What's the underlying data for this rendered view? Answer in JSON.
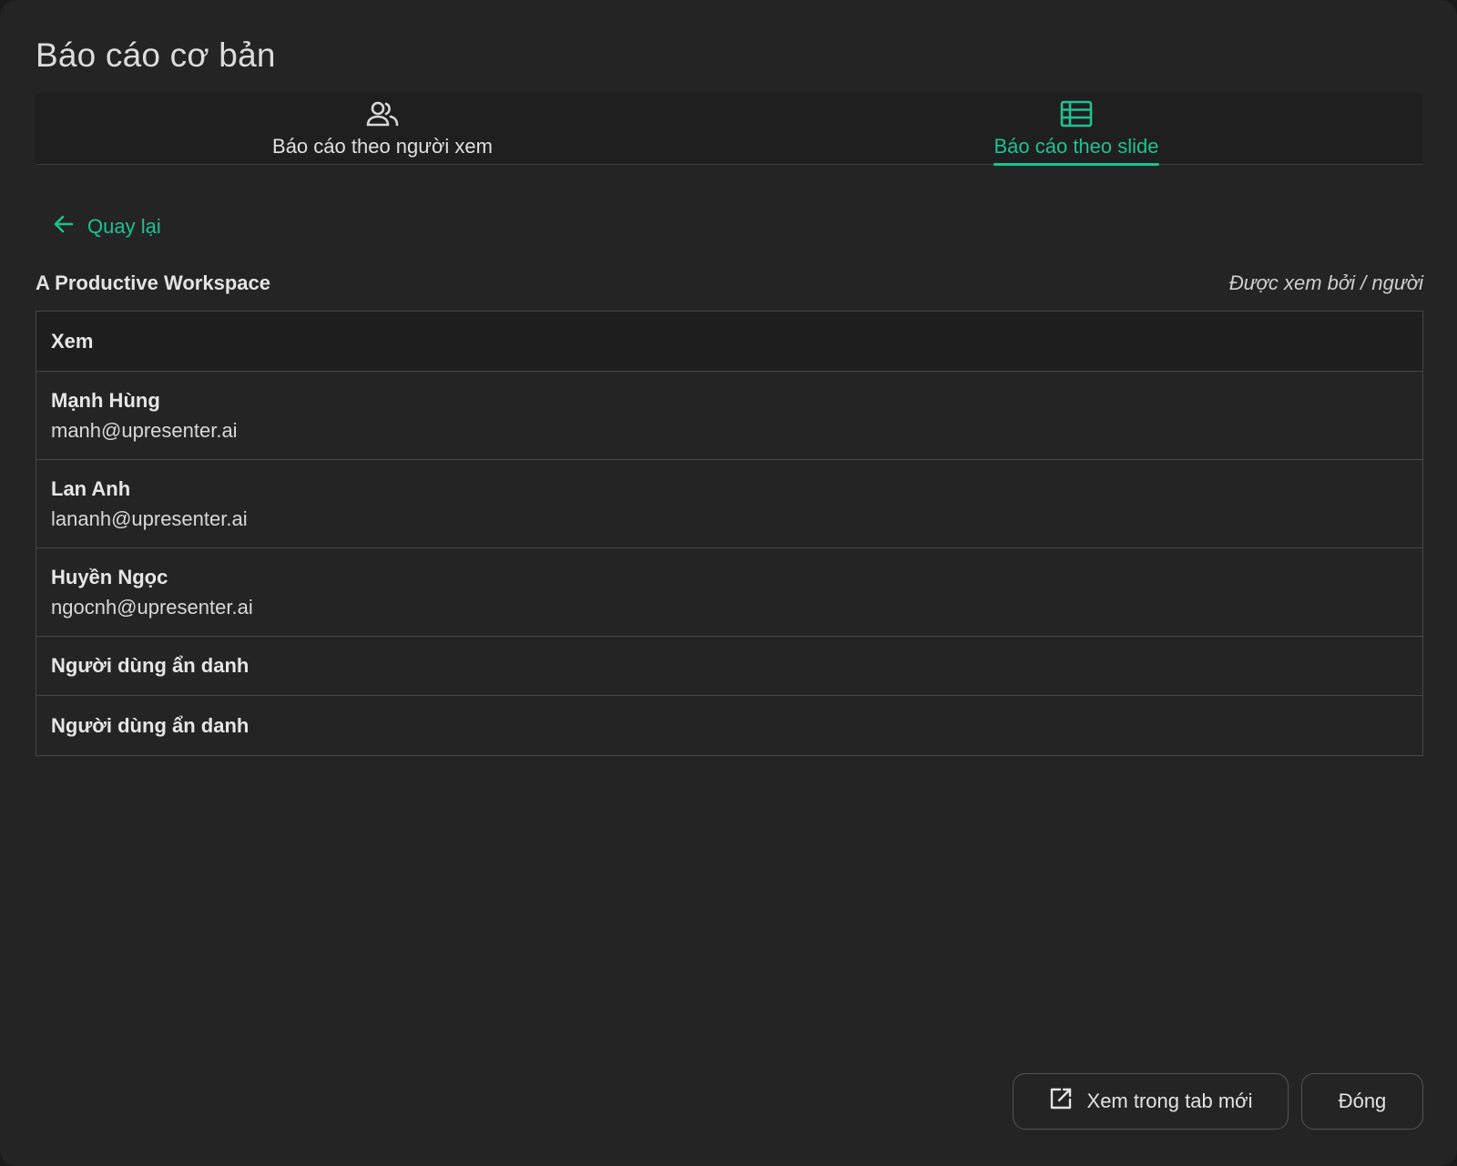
{
  "dialog": {
    "title": "Báo cáo cơ bản"
  },
  "tabs": [
    {
      "label": "Báo cáo theo người xem",
      "icon": "users-icon",
      "active": false
    },
    {
      "label": "Báo cáo theo slide",
      "icon": "table-list-icon",
      "active": true
    }
  ],
  "back": {
    "label": "Quay lại",
    "icon": "arrow-left-icon"
  },
  "slide": {
    "title": "A Productive Workspace",
    "viewed_by": "Được xem bởi / người"
  },
  "table": {
    "header": "Xem",
    "rows": [
      {
        "name": "Mạnh Hùng",
        "email": "manh@upresenter.ai"
      },
      {
        "name": "Lan Anh",
        "email": "lananh@upresenter.ai"
      },
      {
        "name": "Huyền Ngọc",
        "email": "ngocnh@upresenter.ai"
      },
      {
        "name": "Người dùng ẩn danh"
      },
      {
        "name": "Người dùng ẩn danh"
      }
    ]
  },
  "footer": {
    "open_new_tab_label": "Xem trong tab mới",
    "open_new_tab_icon": "open-external-icon",
    "close_label": "Đóng"
  },
  "colors": {
    "accent": "#1fc28f",
    "background": "#242424",
    "border": "#474747"
  }
}
